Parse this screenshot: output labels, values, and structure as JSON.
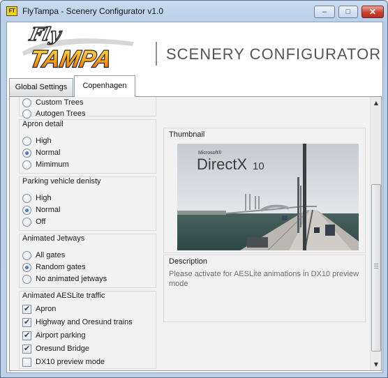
{
  "window": {
    "icon_text": "FT",
    "title": "FlyTampa - Scenery Configurator v1.0",
    "min_glyph": "–",
    "max_glyph": "□",
    "close_glyph": "✕"
  },
  "header": {
    "logo_fly": "Fly",
    "logo_tampa": "TAMPA",
    "title": "SCENERY CONFIGURATOR"
  },
  "tabs": [
    {
      "label": "Global Settings",
      "selected": false
    },
    {
      "label": "Copenhagen",
      "selected": true
    }
  ],
  "settings": {
    "trees": {
      "options": [
        {
          "label": "Custom Trees",
          "selected": false
        },
        {
          "label": "Autogen Trees",
          "selected": false
        }
      ]
    },
    "apron_detail": {
      "title": "Apron detail",
      "options": [
        {
          "label": "High",
          "selected": false
        },
        {
          "label": "Normal",
          "selected": true
        },
        {
          "label": "Mimimum",
          "selected": false
        }
      ]
    },
    "parking_vehicle": {
      "title": "Parking vehicle denisty",
      "options": [
        {
          "label": "High",
          "selected": false
        },
        {
          "label": "Normal",
          "selected": true
        },
        {
          "label": "Off",
          "selected": false
        }
      ]
    },
    "jetways": {
      "title": "Animated Jetways",
      "options": [
        {
          "label": "All gates",
          "selected": false
        },
        {
          "label": "Random gates",
          "selected": true
        },
        {
          "label": "No animated jetways",
          "selected": false
        }
      ]
    },
    "traffic": {
      "title": "Animated AESLite traffic",
      "options": [
        {
          "label": "Apron",
          "checked": true
        },
        {
          "label": "Highway and Oresund trains",
          "checked": true
        },
        {
          "label": "Airport parking",
          "checked": true
        },
        {
          "label": "Oresund Bridge",
          "checked": true
        },
        {
          "label": "DX10 preview mode",
          "checked": false
        }
      ]
    }
  },
  "thumbnail": {
    "label": "Thumbnail",
    "image_text_brand": "Microsoft®",
    "image_text_product": "DirectX",
    "image_text_version": "10"
  },
  "description": {
    "label": "Description",
    "text": "Please activate for AESLite animations in DX10 preview mode"
  },
  "scrollbar": {
    "up_glyph": "▲",
    "down_glyph": "▼"
  },
  "colors": {
    "logo_orange": "#f07a12",
    "logo_yellow": "#ffd21c",
    "radio_dot": "#1c4a9f",
    "close_red": "#c6432e"
  }
}
